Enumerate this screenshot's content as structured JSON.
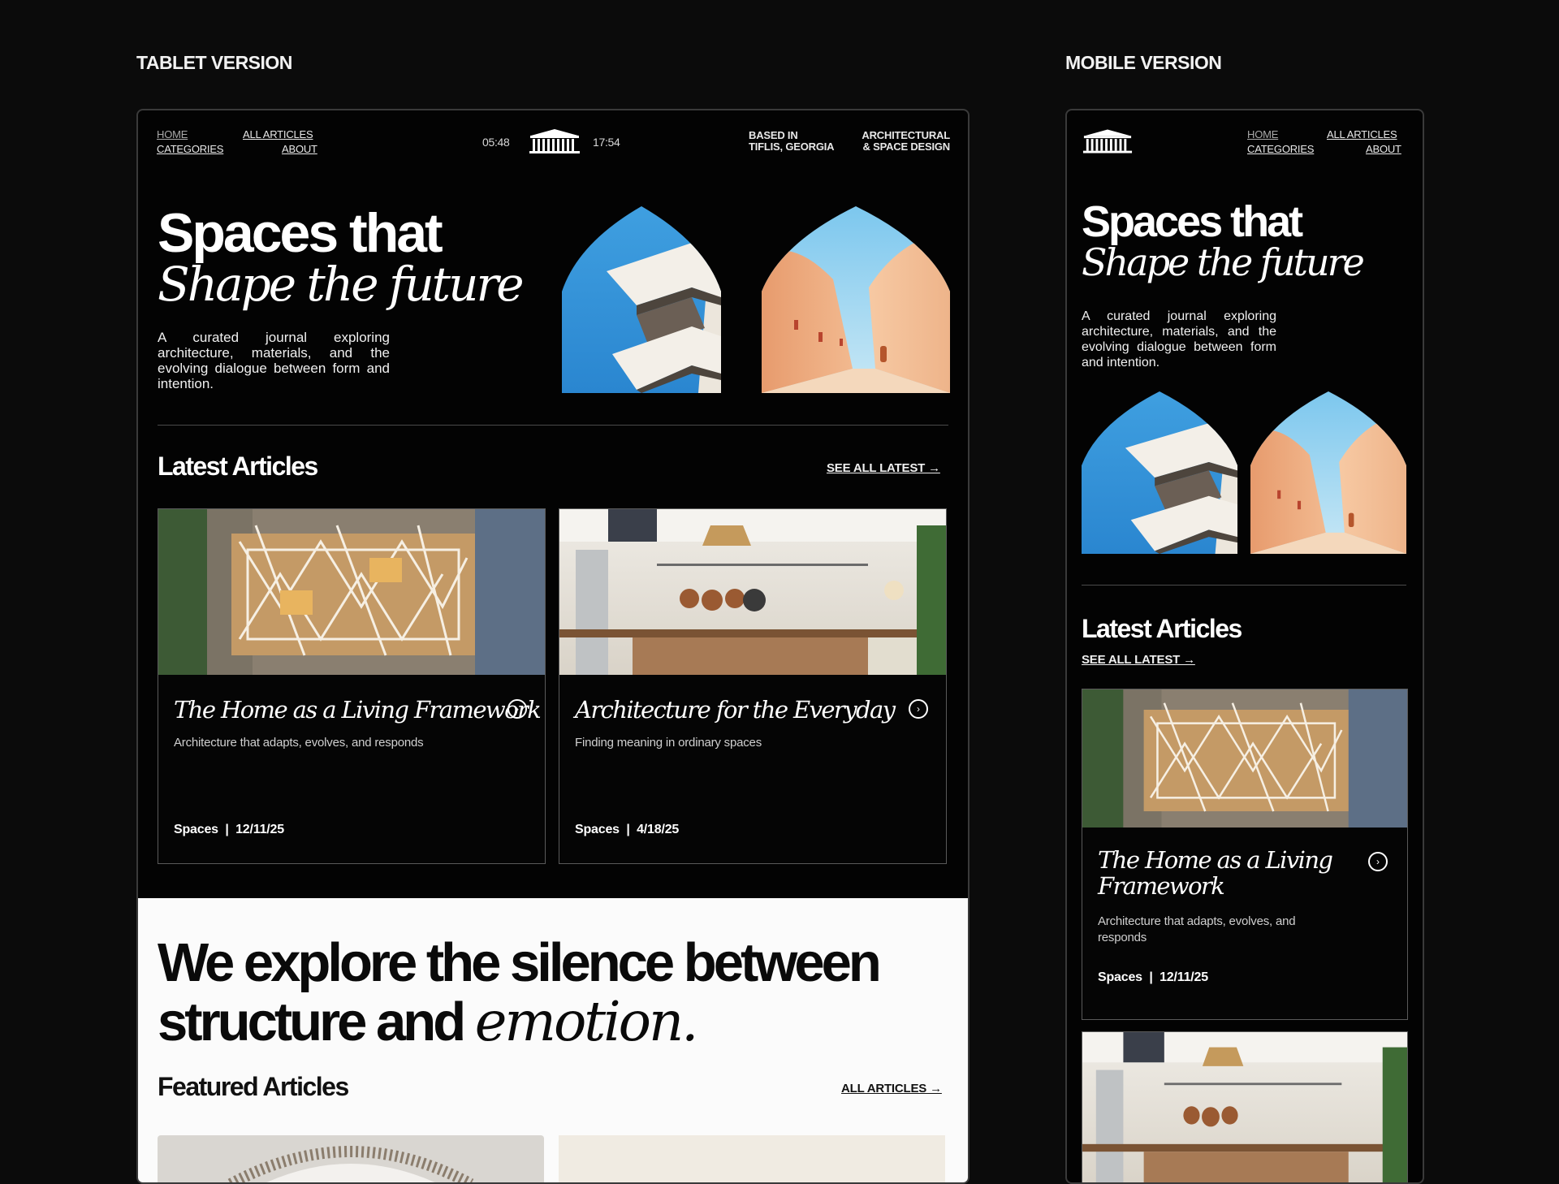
{
  "labels": {
    "tablet": "TABLET VERSION",
    "mobile": "MOBILE VERSION"
  },
  "nav": {
    "home": "HOME",
    "all_articles": "ALL ARTICLES",
    "categories": "CATEGORIES",
    "about": "ABOUT"
  },
  "header": {
    "time_left": "05:48",
    "time_right": "17:54",
    "based_in": [
      "BASED IN",
      "TIFLIS, GEORGIA"
    ],
    "discipline": [
      "ARCHITECTURAL",
      "& SPACE DESIGN"
    ],
    "logo_icon": "temple-icon"
  },
  "hero": {
    "line1": "Spaces that",
    "line2": "Shape the future",
    "description": "A curated journal exploring architecture, materials, and the evolving dialogue between form and intention."
  },
  "latest": {
    "heading": "Latest Articles",
    "see_all": "SEE ALL LATEST →",
    "articles": [
      {
        "title": "The Home as a Living Framework",
        "mobile_title_l1": "The Home as a Living",
        "mobile_title_l2": "Framework",
        "subtitle": "Architecture that adapts, evolves, and responds",
        "category": "Spaces",
        "date": "12/11/25"
      },
      {
        "title": "Architecture for the Everyday",
        "subtitle": "Finding meaning in ordinary spaces",
        "category": "Spaces",
        "date": "4/18/25"
      }
    ]
  },
  "statement": {
    "line1": "We explore the silence between",
    "line2_plain": "structure and",
    "line2_italic": "emotion."
  },
  "featured": {
    "heading": "Featured Articles",
    "all": "ALL ARTICLES →"
  },
  "colors": {
    "background": "#0b0b0b",
    "frame": "#030303",
    "light_section": "#fbfbfb",
    "sky": "#3ba1de",
    "terracotta": "#e8a27a"
  }
}
